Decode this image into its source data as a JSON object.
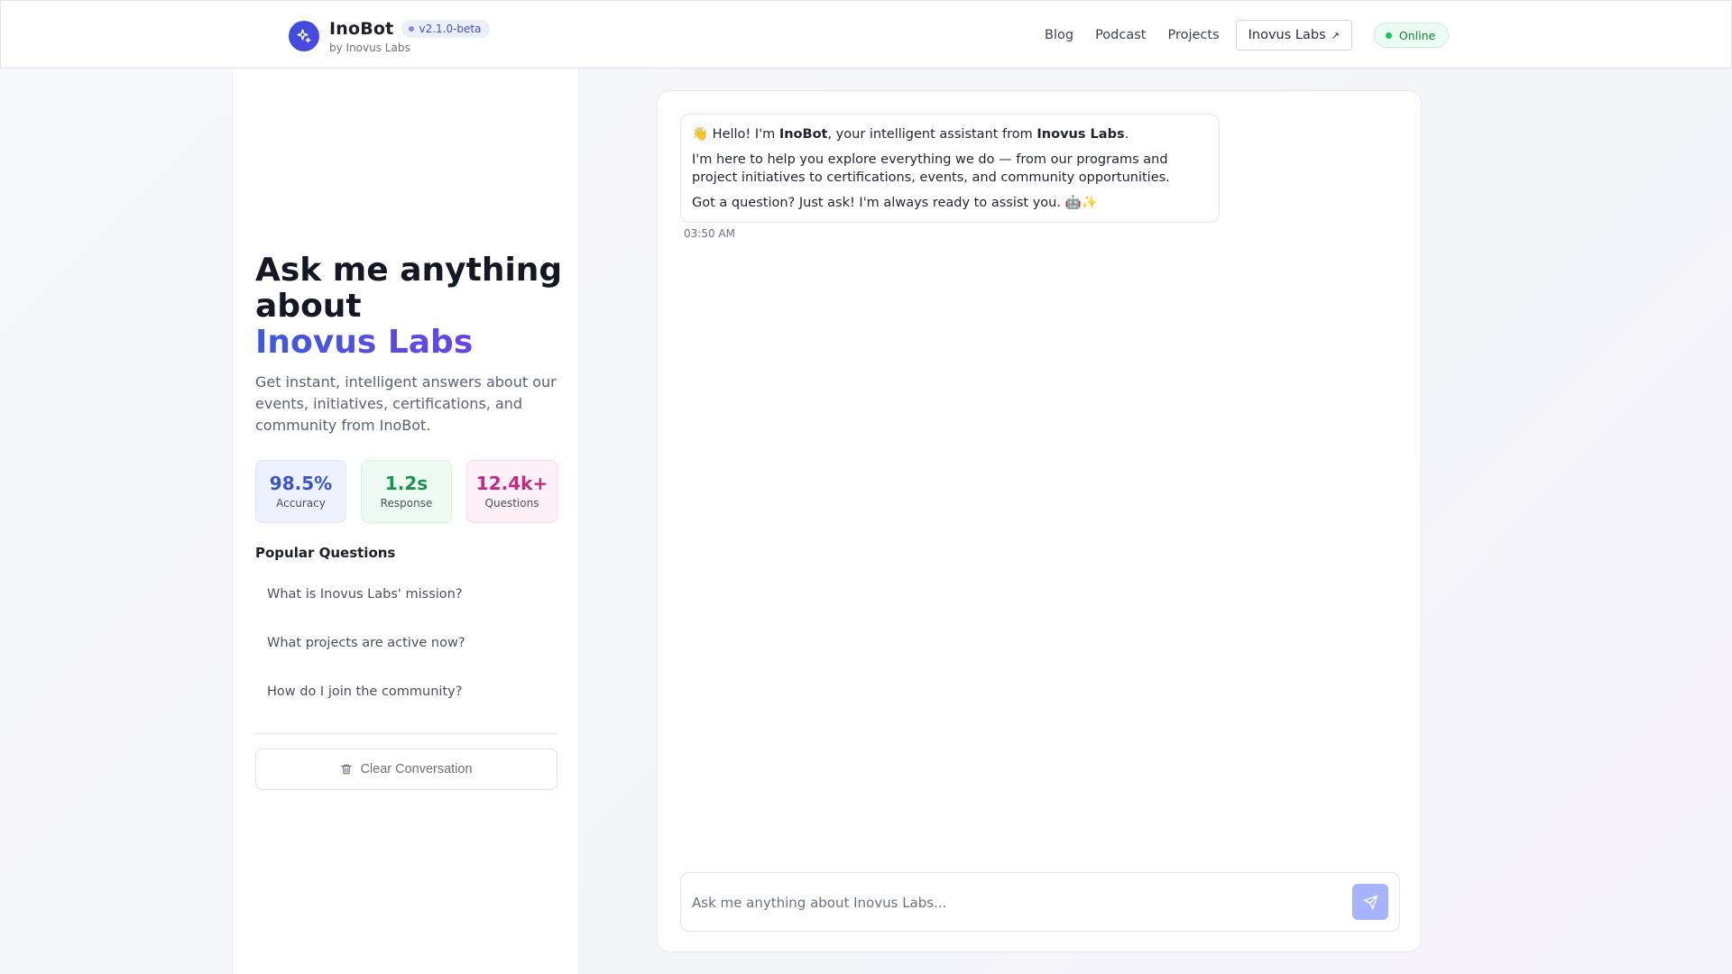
{
  "header": {
    "brand_name": "InoBot",
    "version": "v2.1.0-beta",
    "byline": "by Inovus Labs",
    "nav": [
      "Blog",
      "Podcast",
      "Projects"
    ],
    "external_link": "Inovus Labs",
    "external_icon": "external-arrow-icon",
    "status": "Online",
    "status_color": "#22c55e"
  },
  "sidebar": {
    "title_line1": "Ask me anything",
    "title_line2": "about",
    "title_accent": "Inovus Labs",
    "description": "Get instant, intelligent answers about our events, initiatives, certifications, and community from InoBot.",
    "stats": [
      {
        "value": "98.5%",
        "label": "Accuracy"
      },
      {
        "value": "1.2s",
        "label": "Response"
      },
      {
        "value": "12.4k+",
        "label": "Questions"
      }
    ],
    "popular_title": "Popular Questions",
    "popular_questions": [
      "What is Inovus Labs' mission?",
      "What projects are active now?",
      "How do I join the community?"
    ],
    "clear_label": "Clear Conversation",
    "clear_icon": "trash-icon"
  },
  "chat": {
    "message": {
      "line1_prefix": "👋 Hello! I'm ",
      "line1_bot": "InoBot",
      "line1_mid": ", your intelligent assistant from ",
      "line1_org": "Inovus Labs",
      "line1_suffix": ".",
      "line2": "I'm here to help you explore everything we do — from our programs and project initiatives to certifications, events, and community opportunities.",
      "line3": "Got a question? Just ask! I'm always ready to assist you. 🤖✨"
    },
    "timestamp": "03:50 AM",
    "input_placeholder": "Ask me anything about Inovus Labs...",
    "input_value": "",
    "send_icon": "send-icon",
    "accent_color": "#a5b4fc"
  }
}
